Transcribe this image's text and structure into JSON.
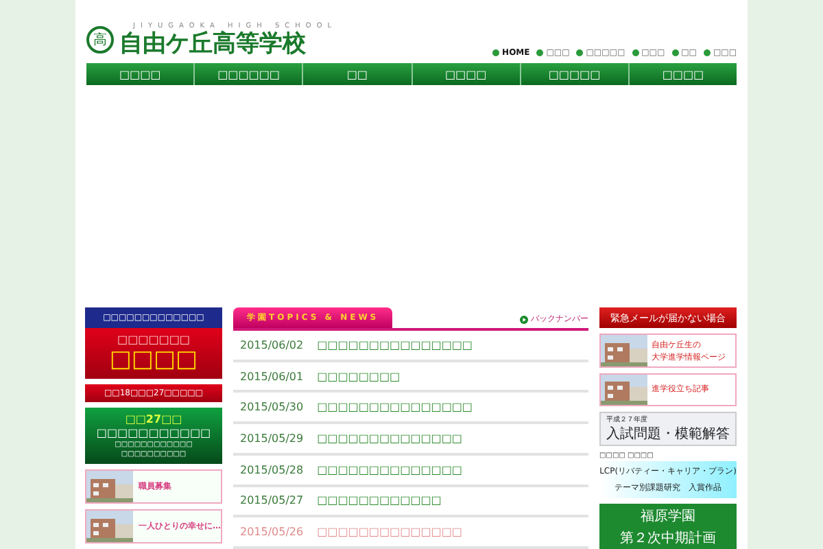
{
  "header": {
    "emblem": "高",
    "subtitle": "JIYUGAOKA HIGH SCHOOL",
    "title": "自由ケ丘高等学校",
    "top_links": [
      {
        "label": "HOME",
        "selected": true
      },
      {
        "label": "□□□",
        "selected": false
      },
      {
        "label": "□□□□□",
        "selected": false
      },
      {
        "label": "□□□",
        "selected": false
      },
      {
        "label": "□□",
        "selected": false
      },
      {
        "label": "□□□",
        "selected": false
      }
    ]
  },
  "nav": [
    "□□□□",
    "□□□□□□",
    "□□",
    "□□□□",
    "□□□□□",
    "□□□□"
  ],
  "left": {
    "notice": "□□□□□□□□□□□□□",
    "red_banner": {
      "line1": "□□□□□□□",
      "line2": "□□□□"
    },
    "dates_bar": "□□18□□□27□□□□□",
    "green_banner": {
      "line1": "□□27□□",
      "line2": "□□□□□□□□□□□",
      "line3": "□□□□□□□□□□□□",
      "line4": "□□□□□□□□□□"
    },
    "cards": [
      {
        "label": "職員募集"
      },
      {
        "label": "一人ひとりの幸せに…"
      }
    ]
  },
  "news": {
    "title": "学園TOPICS & NEWS",
    "back_number": "バックナンバー",
    "items": [
      {
        "date": "2015/06/02",
        "title": "□□□□□□□□□□□□□□□",
        "dimmed": false
      },
      {
        "date": "2015/06/01",
        "title": "□□□□□□□□",
        "dimmed": false
      },
      {
        "date": "2015/05/30",
        "title": "□□□□□□□□□□□□□□□",
        "dimmed": false
      },
      {
        "date": "2015/05/29",
        "title": "□□□□□□□□□□□□□□",
        "dimmed": false
      },
      {
        "date": "2015/05/28",
        "title": "□□□□□□□□□□□□□□",
        "dimmed": false
      },
      {
        "date": "2015/05/27",
        "title": "□□□□□□□□□□□□",
        "dimmed": false
      },
      {
        "date": "2015/05/26",
        "title": "□□□□□□□□□□□□□□",
        "dimmed": true
      }
    ]
  },
  "right": [
    {
      "kind": "red",
      "lines": [
        "緊急メールが届かない場合"
      ]
    },
    {
      "lines": [
        "自由ケ丘生の",
        "大学進学情報ページ"
      ]
    },
    {
      "lines": [
        "進学役立ち記事"
      ]
    },
    {
      "kind": "gray",
      "lines": [
        "平成２７年度",
        "入試問題・模範解答"
      ]
    },
    {
      "kind": "cyan",
      "caption": "□□□□ □□□□",
      "lines": [
        "LCP(リバティー・キャリア・プラン)",
        "テーマ別課題研究　入賞作品"
      ]
    },
    {
      "kind": "green",
      "lines": [
        "福原学園",
        "第２次中期計画"
      ]
    }
  ]
}
